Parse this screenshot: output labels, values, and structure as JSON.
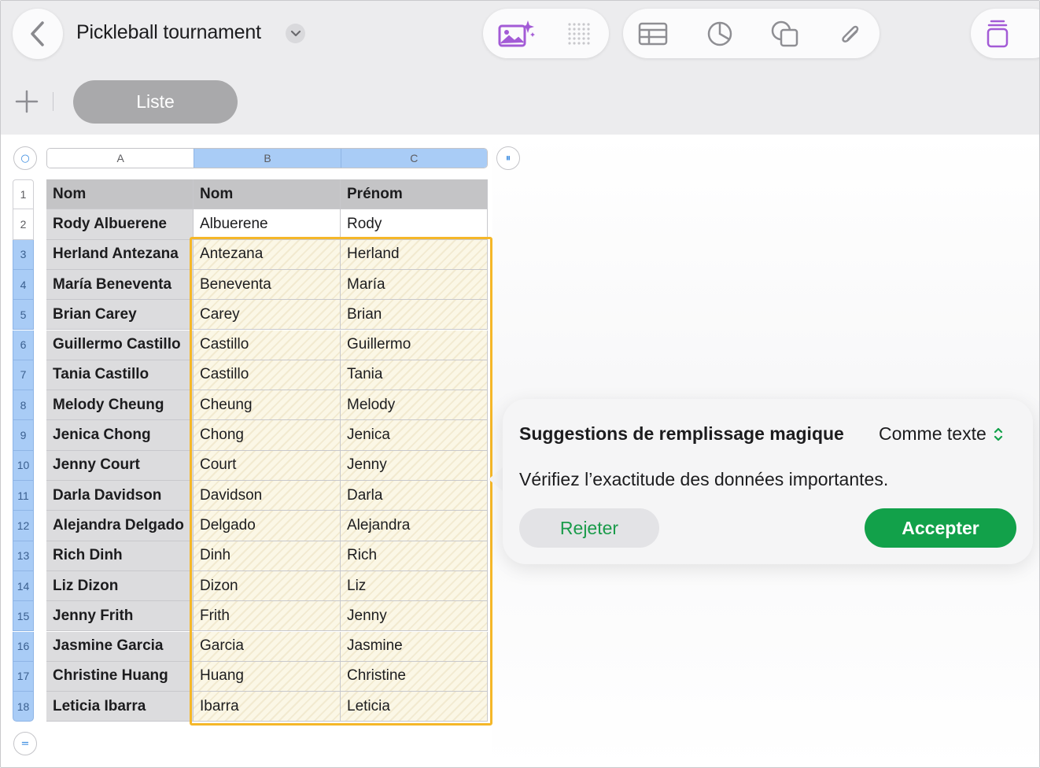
{
  "toolbar": {
    "title": "Pickleball tournament",
    "icons": [
      "back-chevron-icon",
      "chevron-down-icon",
      "image-sparkle-icon",
      "dot-grid-icon",
      "table-icon",
      "chart-icon",
      "shape-icon",
      "paperclip-icon",
      "format-panel-icon"
    ]
  },
  "sheet": {
    "tab_label": "Liste",
    "add_icon": "plus-icon"
  },
  "columns": [
    "A",
    "B",
    "C"
  ],
  "table": {
    "headers": [
      "Nom",
      "Nom",
      "Prénom"
    ],
    "rows": [
      [
        "Rody Albuerene",
        "Albuerene",
        "Rody"
      ],
      [
        "Herland Antezana",
        "Antezana",
        "Herland"
      ],
      [
        "María Beneventa",
        "Beneventa",
        "María"
      ],
      [
        "Brian Carey",
        "Carey",
        "Brian"
      ],
      [
        "Guillermo Castillo",
        "Castillo",
        "Guillermo"
      ],
      [
        "Tania Castillo",
        "Castillo",
        "Tania"
      ],
      [
        "Melody Cheung",
        "Cheung",
        "Melody"
      ],
      [
        "Jenica Chong",
        "Chong",
        "Jenica"
      ],
      [
        "Jenny Court",
        "Court",
        "Jenny"
      ],
      [
        "Darla Davidson",
        "Davidson",
        "Darla"
      ],
      [
        "Alejandra Delgado",
        "Delgado",
        "Alejandra"
      ],
      [
        "Rich Dinh",
        "Dinh",
        "Rich"
      ],
      [
        "Liz Dizon",
        "Dizon",
        "Liz"
      ],
      [
        "Jenny Frith",
        "Frith",
        "Jenny"
      ],
      [
        "Jasmine Garcia",
        "Garcia",
        "Jasmine"
      ],
      [
        "Christine Huang",
        "Huang",
        "Christine"
      ],
      [
        "Leticia Ibarra",
        "Ibarra",
        "Leticia"
      ]
    ],
    "row_numbers": [
      "1",
      "2",
      "3",
      "4",
      "5",
      "6",
      "7",
      "8",
      "9",
      "10",
      "11",
      "12",
      "13",
      "14",
      "15",
      "16",
      "17",
      "18"
    ],
    "selected_rows": [
      3,
      18
    ]
  },
  "popover": {
    "title": "Suggestions de remplissage magique",
    "mode": "Comme texte",
    "message": "Vérifiez l’exactitude des données importantes.",
    "reject_label": "Rejeter",
    "accept_label": "Accepter"
  },
  "colors": {
    "accent": "#12a14a",
    "selection": "#f5b728",
    "header_select": "#a9ccf6",
    "toolbar_purple": "#a35bd6"
  }
}
